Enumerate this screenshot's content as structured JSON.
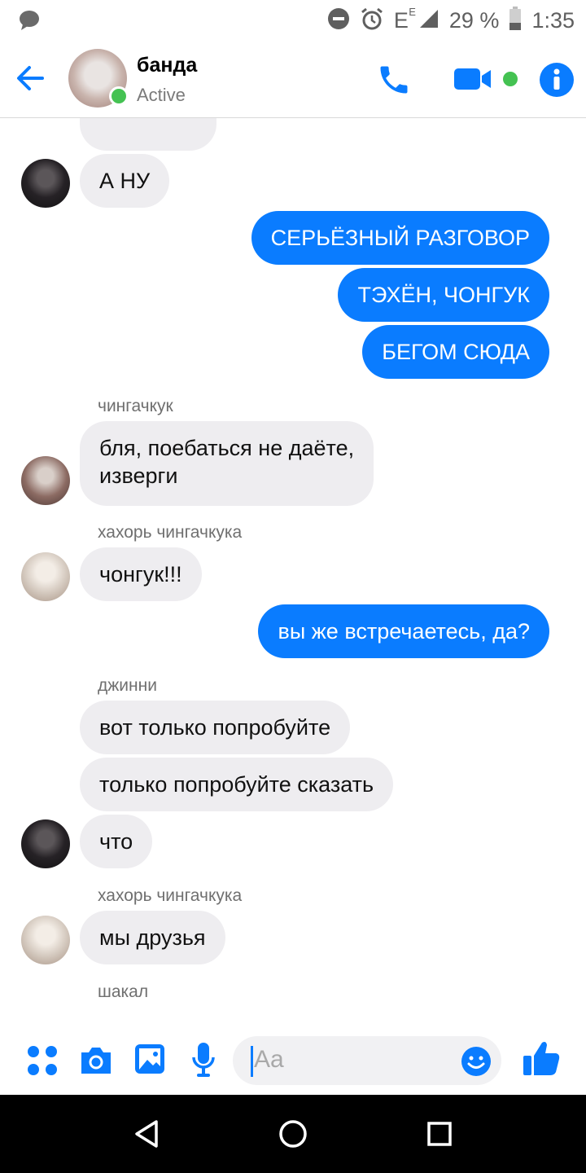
{
  "status_bar": {
    "network": "E",
    "network_sup": "E",
    "battery": "29 %",
    "time": "1:35"
  },
  "header": {
    "title": "банда",
    "subtitle": "Active"
  },
  "messages": {
    "m0": "А НУ",
    "m1": "СЕРЬЁЗНЫЙ РАЗГОВОР",
    "m2": "ТЭХЁН, ЧОНГУК",
    "m3": "БЕГОМ СЮДА",
    "n1": "чингачкук",
    "m4a": "бля, поебаться не даёте,",
    "m4b": "изверги",
    "n2": "хахорь чингачкука",
    "m5": "чонгук!!!",
    "m6": "вы же встречаетесь, да?",
    "n3": "джинни",
    "m7": "вот только попробуйте",
    "m8": "только попробуйте сказать",
    "m9": "что",
    "n4": "хахорь чингачкука",
    "m10": "мы друзья",
    "n5": "шакал"
  },
  "composer": {
    "placeholder": "Aa"
  },
  "colors": {
    "accent": "#0a7cff",
    "incoming_bubble": "#eeedf0",
    "online": "#44c252"
  }
}
